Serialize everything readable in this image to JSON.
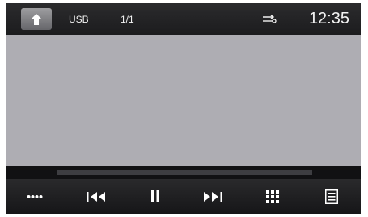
{
  "status_bar": {
    "source_label": "USB",
    "track_counter": "1/1",
    "clock": "12:35",
    "icons": [
      "home-icon",
      "repeat-icon"
    ]
  },
  "playback": {
    "progress": 0.0
  },
  "controls": {
    "icons": [
      "more-icon",
      "previous-icon",
      "pause-icon",
      "next-icon",
      "grid-icon",
      "list-icon"
    ]
  },
  "colors": {
    "video_area": "#aeadb3",
    "bar_background": "#1b1b1d",
    "icon": "#ffffff"
  }
}
